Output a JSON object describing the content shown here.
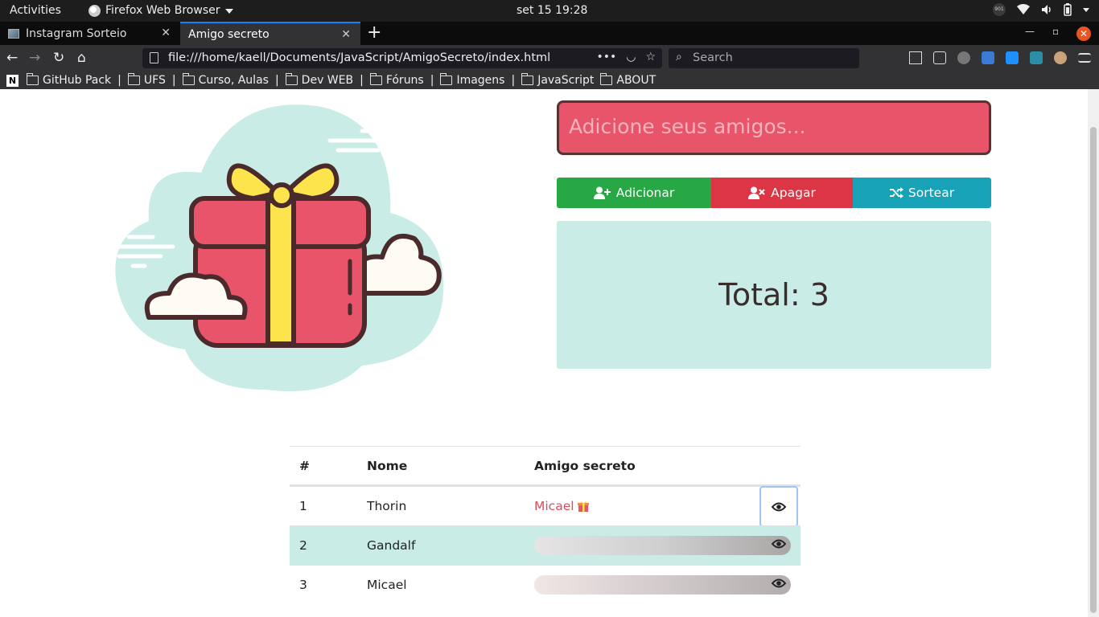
{
  "topbar": {
    "activities": "Activities",
    "app_name": "Firefox Web Browser",
    "clock": "set 15  19:28",
    "tray_badge": "901"
  },
  "tabs": [
    {
      "label": "Instagram Sorteio",
      "active": false
    },
    {
      "label": "Amigo secreto",
      "active": true
    }
  ],
  "navbar": {
    "url": "file:///home/kaell/Documents/JavaScript/AmigoSecreto/index.html",
    "url_more": "•••",
    "search_placeholder": "Search"
  },
  "bookmarks": [
    {
      "label": "GitHub Pack"
    },
    {
      "label": "UFS"
    },
    {
      "label": "Curso, Aulas"
    },
    {
      "label": "Dev WEB"
    },
    {
      "label": "Fóruns"
    },
    {
      "label": "Imagens"
    },
    {
      "label": "JavaScript"
    },
    {
      "label": "ABOUT"
    }
  ],
  "app": {
    "input_placeholder": "Adicione seus amigos...",
    "buttons": {
      "add": "Adicionar",
      "delete": "Apagar",
      "draw": "Sortear"
    },
    "total_text": "Total: 3",
    "table": {
      "headers": {
        "num": "#",
        "name": "Nome",
        "friend": "Amigo secreto"
      },
      "rows": [
        {
          "num": "1",
          "name": "Thorin",
          "friend": "Micael",
          "revealed": true
        },
        {
          "num": "2",
          "name": "Gandalf",
          "friend": "",
          "revealed": false
        },
        {
          "num": "3",
          "name": "Micael",
          "friend": "",
          "revealed": false
        }
      ]
    }
  },
  "colors": {
    "input_bg": "#e85469",
    "add_btn": "#28a745",
    "delete_btn": "#dc3545",
    "draw_btn": "#17a2b8",
    "panel_bg": "#c9ece6",
    "revealed_name": "#e04a5e"
  }
}
